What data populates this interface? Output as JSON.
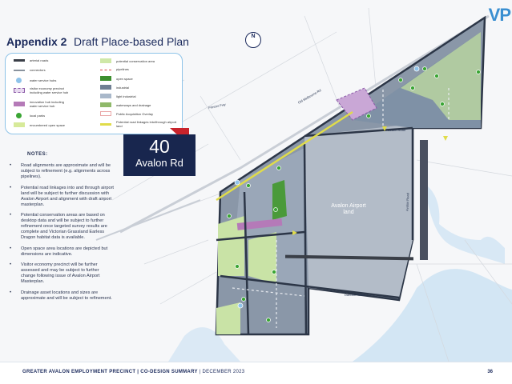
{
  "header": {
    "title": "Appendix 2",
    "subtitle": "Draft Place-based Plan",
    "logo": "VP"
  },
  "legend": {
    "left": [
      {
        "label": "arterial roads",
        "color": "#3a3f48"
      },
      {
        "label": "connectors",
        "color": "#8a939e"
      },
      {
        "label": "water service hubs",
        "color": "#8fc3ea"
      },
      {
        "label": "visitor economy precinct including water service hub",
        "color": "#8b5aa8"
      },
      {
        "label": "innovation hub including water service hub",
        "color": "#b57ab8"
      },
      {
        "label": "local parks",
        "color": "#3aa534"
      },
      {
        "label": "encumbered open space",
        "color": "#d7ea9a"
      }
    ],
    "right": [
      {
        "label": "potential conservation area",
        "color": "#cfe8a8"
      },
      {
        "label": "pipelines",
        "color": "#d84a4a"
      },
      {
        "label": "open space",
        "color": "#3d8f2f"
      },
      {
        "label": "industrial",
        "color": "#6f7f93"
      },
      {
        "label": "light industrial",
        "color": "#a9b8ca"
      },
      {
        "label": "waterways and drainage",
        "color": "#8fb96a"
      },
      {
        "label": "Public Acquisition Overlay",
        "color": "#f2c8c8"
      },
      {
        "label": "Potential road linkages into/through airport land",
        "color": "#e0dc4a"
      }
    ]
  },
  "notes": {
    "title": "NOTES:",
    "items": [
      "Road alignments are approximate and will be subject to refinement (e.g. alignments across pipelines).",
      "Potential road linkages into and through airport land will be subject to further discussion with Avalon Airport and alignment with draft airport masterplan.",
      "Potential conservation areas are based on desktop data and will be subject to further refinement once targeted survey results are complete and Victorian Grassland Earless Dragon habitat data is available.",
      "Open space area locations are depicted but dimensions are indicative.",
      "Visitor economy precinct will be further assessed and may be subject to further change following issue of Avalon Airport Masterplan.",
      "Drainage asset locations and sizes are approximate and will be subject to refinement."
    ]
  },
  "site": {
    "number": "40",
    "road": "Avalon Rd"
  },
  "map": {
    "north": "N",
    "airport_label": "Avalon Airport land",
    "roads": [
      "Beach Road",
      "Avalon Road",
      "Dandos Road",
      "Princes Fwy",
      "Old Melbourne Rd"
    ],
    "colors": {
      "industrial": "#6f7f93",
      "light_industrial": "#a9b8ca",
      "open_space": "#3d8f2f",
      "conservation": "#cfe8a8",
      "arterial": "#3a3f48",
      "precinct": "#8b5aa8"
    }
  },
  "footer": {
    "left_bold": "GREATER AVALON EMPLOYMENT PRECINCT",
    "left_light": "CO-DESIGN SUMMARY",
    "date": "DECEMBER 2023",
    "page": "36"
  }
}
